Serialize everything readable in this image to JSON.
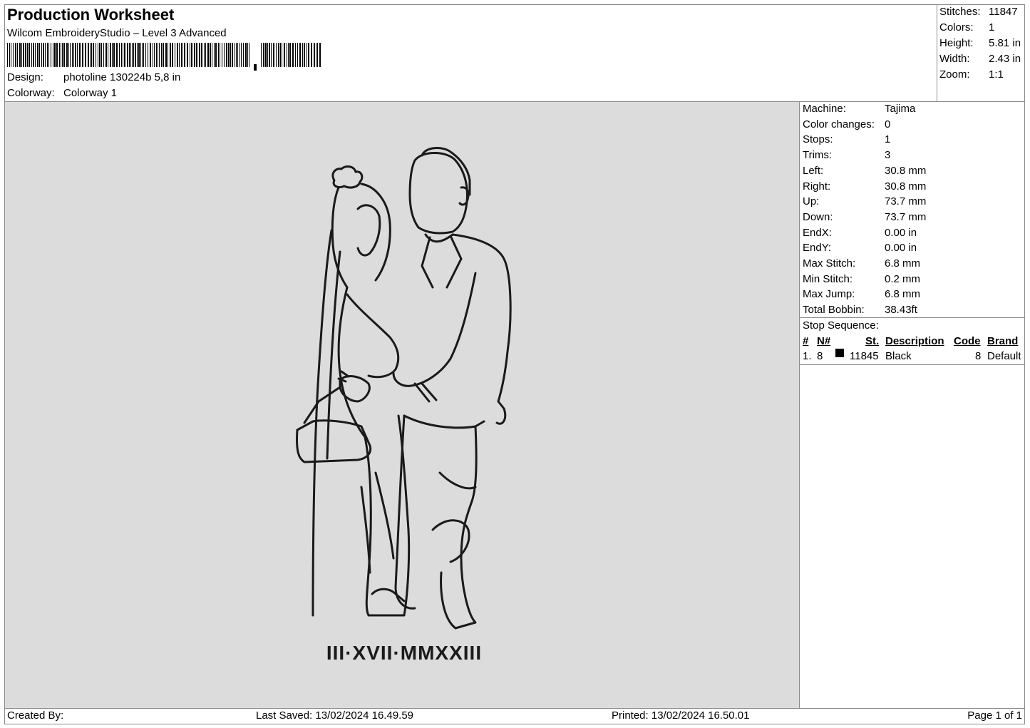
{
  "header": {
    "title": "Production Worksheet",
    "subtitle": "Wilcom EmbroideryStudio – Level 3 Advanced",
    "design_label": "Design:",
    "design_value": "photoline 130224b 5,8 in",
    "colorway_label": "Colorway:",
    "colorway_value": "Colorway 1"
  },
  "summary": {
    "stitches_label": "Stitches:",
    "stitches_value": "11847",
    "colors_label": "Colors:",
    "colors_value": "1",
    "height_label": "Height:",
    "height_value": "5.81 in",
    "width_label": "Width:",
    "width_value": "2.43 in",
    "zoom_label": "Zoom:",
    "zoom_value": "1:1"
  },
  "properties": [
    {
      "label": "Machine:",
      "value": "Tajima"
    },
    {
      "label": "Color changes:",
      "value": "0"
    },
    {
      "label": "Stops:",
      "value": "1"
    },
    {
      "label": "Trims:",
      "value": "3"
    },
    {
      "label": "Left:",
      "value": "30.8 mm"
    },
    {
      "label": "Right:",
      "value": "30.8 mm"
    },
    {
      "label": "Up:",
      "value": "73.7 mm"
    },
    {
      "label": "Down:",
      "value": "73.7 mm"
    },
    {
      "label": "EndX:",
      "value": "0.00 in"
    },
    {
      "label": "EndY:",
      "value": "0.00 in"
    },
    {
      "label": "Max Stitch:",
      "value": "6.8 mm"
    },
    {
      "label": "Min Stitch:",
      "value": "0.2 mm"
    },
    {
      "label": "Max Jump:",
      "value": "6.8 mm"
    },
    {
      "label": "Total Bobbin:",
      "value": "38.43ft"
    }
  ],
  "stop_sequence": {
    "title": "Stop Sequence:",
    "headers": {
      "num": "#",
      "n": "N#",
      "st": "St.",
      "description": "Description",
      "code": "Code",
      "brand": "Brand"
    },
    "rows": [
      {
        "num": "1.",
        "n": "8",
        "swatch_color": "#000000",
        "st": "11845",
        "description": "Black",
        "code": "8",
        "brand": "Default"
      }
    ]
  },
  "design_text": "III·XVII·MMXXIII",
  "footer": {
    "created_by": "Created By:",
    "last_saved": "Last Saved: 13/02/2024 16.49.59",
    "printed": "Printed: 13/02/2024 16.50.01",
    "page": "Page 1 of 1"
  },
  "colors": {
    "canvas_bg": "#dcdcdc",
    "thread": "#1a1a1a",
    "border": "#8a8a8a"
  }
}
